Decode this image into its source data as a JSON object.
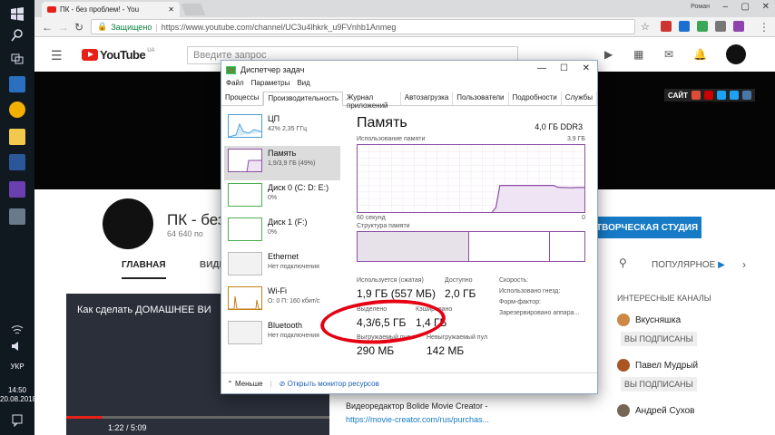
{
  "taskbar": {
    "time": "14:50",
    "date": "20.08.2018",
    "lang": "УКР"
  },
  "browser": {
    "tab_title": "ПК - без проблем! - You",
    "profile": "Роман",
    "secure_label": "Защищено",
    "url": "https://www.youtube.com/channel/UC3u4lhkrk_u9FVnhb1Anmeg"
  },
  "youtube": {
    "logo": "YouTube",
    "region": "UA",
    "search_placeholder": "Введите запрос",
    "banner_site": "САЙТ",
    "channel_name": "ПК - без",
    "channel_subs": "64 640 по",
    "studio_button": "ТВОРЧЕСКАЯ СТУДИЯ",
    "tab_main": "ГЛАВНАЯ",
    "tab_video": "ВИДЕ",
    "popular": "ПОПУЛЯРНОЕ",
    "video_caption": "Как сделать ДОМАШНЕЕ ВИ",
    "video_time": "1:22 / 5:09",
    "desc_line": "Видеоредактор Bolide Movie Creator -",
    "desc_link": "https://movie-creator.com/rus/purchas...",
    "channels_header": "ИНТЕРЕСНЫЕ КАНАЛЫ",
    "channels": [
      {
        "name": "Вкусняшка",
        "sub": "ВЫ ПОДПИСАНЫ"
      },
      {
        "name": "Павел Мудрый",
        "sub": "ВЫ ПОДПИСАНЫ"
      },
      {
        "name": "Андрей Сухов",
        "sub": ""
      }
    ]
  },
  "taskmgr": {
    "title": "Диспетчер задач",
    "menu": [
      "Файл",
      "Параметры",
      "Вид"
    ],
    "tabs": [
      "Процессы",
      "Производительность",
      "Журнал приложений",
      "Автозагрузка",
      "Пользователи",
      "Подробности",
      "Службы"
    ],
    "resources": [
      {
        "name": "ЦП",
        "sub": "42% 2,35 ГГц"
      },
      {
        "name": "Память",
        "sub": "1,9/3,9 ГБ (49%)"
      },
      {
        "name": "Диск 0 (C: D: E:)",
        "sub": "0%"
      },
      {
        "name": "Диск 1 (F:)",
        "sub": "0%"
      },
      {
        "name": "Ethernet",
        "sub": "Нет подключения"
      },
      {
        "name": "Wi-Fi",
        "sub": "О: 0 П: 160 кбит/с"
      },
      {
        "name": "Bluetooth",
        "sub": "Нет подключения"
      }
    ],
    "memory": {
      "title": "Память",
      "total": "4,0 ГБ DDR3",
      "usage_label": "Использование памяти",
      "usage_max": "3,9 ГБ",
      "axis_left": "60 секунд",
      "axis_right": "0",
      "composition_label": "Структура памяти",
      "composition": {
        "in_use_fraction": 0.49,
        "available_fraction": 0.355
      },
      "usage_series": [
        0,
        0,
        0,
        0,
        0,
        0,
        0,
        0,
        0,
        0,
        0,
        0,
        0,
        0,
        0,
        0,
        0,
        0,
        0,
        0,
        0,
        0,
        0,
        0,
        0,
        0,
        0,
        0,
        0,
        0,
        0,
        0,
        0,
        0,
        0,
        0,
        0.27,
        1.55,
        1.55,
        1.55,
        1.55,
        1.55,
        1.55,
        1.55,
        1.55,
        1.55,
        1.55,
        1.55,
        1.55,
        1.55,
        1.55,
        1.55,
        1.45,
        1.43,
        1.43,
        1.42,
        1.42,
        1.43,
        1.43,
        1.43
      ],
      "stats": {
        "in_use_label": "Используется (сжатая)",
        "in_use_value": "1,9 ГБ (557 МБ)",
        "available_label": "Доступно",
        "available_value": "2,0 ГБ",
        "committed_label": "Выделено",
        "committed_value": "4,3/6,5 ГБ",
        "cached_label": "Кэшировано",
        "cached_value": "1,4 ГБ",
        "paged_label": "Выгружаемый пул",
        "paged_value": "290 МБ",
        "nonpaged_label": "Невыгружаемый пул",
        "nonpaged_value": "142 МБ",
        "speed_label": "Скорость:",
        "slots_label": "Использовано гнезд:",
        "form_label": "Форм-фактор:",
        "reserved_label": "Зарезервировано аппара..."
      }
    },
    "footer_less": "Меньше",
    "footer_monitor": "Открыть монитор ресурсов"
  },
  "colors": {
    "memory_accent": "#8e4fa3",
    "youtube_red": "#e62117",
    "annotation_red": "#e40012",
    "studio_blue": "#167ac6"
  }
}
